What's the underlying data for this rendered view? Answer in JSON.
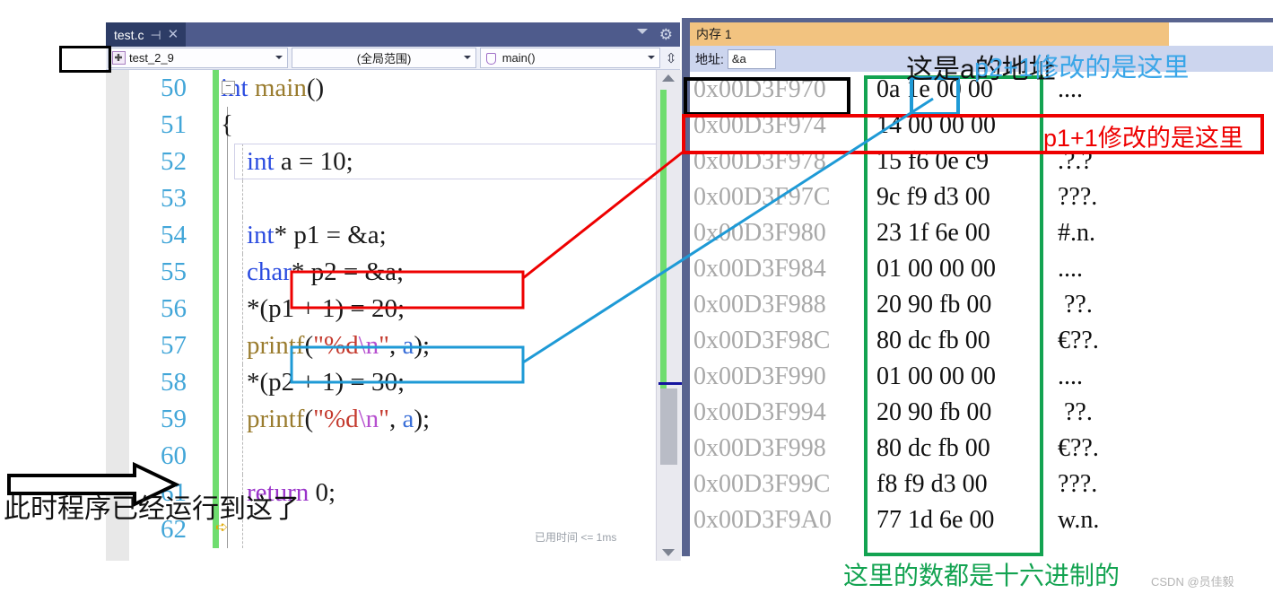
{
  "editor": {
    "tab": {
      "title": "test.c",
      "pin_icon": "pin-icon",
      "close_icon": "close-icon"
    },
    "tabbar": {
      "chevron_icon": "chevron-down-icon",
      "gear_icon": "gear-icon"
    },
    "nav": {
      "project": "test_2_9",
      "scope": "(全局范围)",
      "function": "main()",
      "split_icon": "split-window-icon"
    },
    "first_line_number": 50,
    "lines": [
      {
        "num": "50",
        "tokens": [
          {
            "t": "int ",
            "c": "kw"
          },
          {
            "t": "main",
            "c": "fn"
          },
          {
            "t": "()",
            "c": "pl"
          }
        ]
      },
      {
        "num": "51",
        "tokens": [
          {
            "t": "{",
            "c": "pl"
          }
        ]
      },
      {
        "num": "52",
        "tokens": [
          {
            "t": "    ",
            "c": "pl"
          },
          {
            "t": "int",
            "c": "kw"
          },
          {
            "t": " a = ",
            "c": "pl"
          },
          {
            "t": "10",
            "c": "num"
          },
          {
            "t": ";",
            "c": "pl"
          }
        ]
      },
      {
        "num": "53",
        "tokens": []
      },
      {
        "num": "54",
        "tokens": [
          {
            "t": "    ",
            "c": "pl"
          },
          {
            "t": "int",
            "c": "kw"
          },
          {
            "t": "* p1 = &a;",
            "c": "pl"
          }
        ]
      },
      {
        "num": "55",
        "tokens": [
          {
            "t": "    ",
            "c": "pl"
          },
          {
            "t": "char",
            "c": "kw"
          },
          {
            "t": "* p2 = &a;",
            "c": "pl"
          }
        ]
      },
      {
        "num": "56",
        "tokens": [
          {
            "t": "    *(p1 + 1) = ",
            "c": "pl"
          },
          {
            "t": "20",
            "c": "num"
          },
          {
            "t": ";",
            "c": "pl"
          }
        ]
      },
      {
        "num": "57",
        "tokens": [
          {
            "t": "    ",
            "c": "pl"
          },
          {
            "t": "printf",
            "c": "fn"
          },
          {
            "t": "(",
            "c": "pl"
          },
          {
            "t": "\"%d",
            "c": "str"
          },
          {
            "t": "\\n",
            "c": "esc"
          },
          {
            "t": "\"",
            "c": "str"
          },
          {
            "t": ", ",
            "c": "pl"
          },
          {
            "t": "a",
            "c": "var"
          },
          {
            "t": ");",
            "c": "pl"
          }
        ]
      },
      {
        "num": "58",
        "tokens": [
          {
            "t": "    *(p2 + 1) = ",
            "c": "pl"
          },
          {
            "t": "30",
            "c": "num"
          },
          {
            "t": ";",
            "c": "pl"
          }
        ]
      },
      {
        "num": "59",
        "tokens": [
          {
            "t": "    ",
            "c": "pl"
          },
          {
            "t": "printf",
            "c": "fn"
          },
          {
            "t": "(",
            "c": "pl"
          },
          {
            "t": "\"%d",
            "c": "str"
          },
          {
            "t": "\\n",
            "c": "esc"
          },
          {
            "t": "\"",
            "c": "str"
          },
          {
            "t": ", ",
            "c": "pl"
          },
          {
            "t": "a",
            "c": "var"
          },
          {
            "t": ");",
            "c": "pl"
          }
        ]
      },
      {
        "num": "60",
        "tokens": []
      },
      {
        "num": "61",
        "tokens": [
          {
            "t": "    ",
            "c": "pl"
          },
          {
            "t": "return",
            "c": "ret"
          },
          {
            "t": " ",
            "c": "pl"
          },
          {
            "t": "0",
            "c": "num"
          },
          {
            "t": ";",
            "c": "pl"
          }
        ]
      },
      {
        "num": "62",
        "tokens": [
          {
            "t": "",
            "c": "pl"
          }
        ]
      }
    ],
    "elapsed_time": "已用时间 <= 1ms",
    "execution_pointer_icon": "execution-pointer-icon",
    "collapse_glyph": "−"
  },
  "memory": {
    "tab_title": "内存 1",
    "address_label": "地址:",
    "address_value": "&a",
    "address_placeholder": "地址",
    "rows": [
      {
        "addr": "0x00D3F970",
        "hex": "0a 1e 00 00",
        "ascii": "...."
      },
      {
        "addr": "0x00D3F974",
        "hex": "14 00 00 00",
        "ascii": ""
      },
      {
        "addr": "0x00D3F978",
        "hex": "15 f6 0e c9",
        "ascii": ".?.?"
      },
      {
        "addr": "0x00D3F97C",
        "hex": "9c f9 d3 00",
        "ascii": "???."
      },
      {
        "addr": "0x00D3F980",
        "hex": "23 1f 6e 00",
        "ascii": "#.n."
      },
      {
        "addr": "0x00D3F984",
        "hex": "01 00 00 00",
        "ascii": "...."
      },
      {
        "addr": "0x00D3F988",
        "hex": "20 90 fb 00",
        "ascii": " ??."
      },
      {
        "addr": "0x00D3F98C",
        "hex": "80 dc fb 00",
        "ascii": "€??."
      },
      {
        "addr": "0x00D3F990",
        "hex": "01 00 00 00",
        "ascii": "...."
      },
      {
        "addr": "0x00D3F994",
        "hex": "20 90 fb 00",
        "ascii": " ??."
      },
      {
        "addr": "0x00D3F998",
        "hex": "80 dc fb 00",
        "ascii": "€??."
      },
      {
        "addr": "0x00D3F99C",
        "hex": "f8 f9 d3 00",
        "ascii": "???."
      },
      {
        "addr": "0x00D3F9A0",
        "hex": "77 1d 6e 00",
        "ascii": "w.n."
      }
    ]
  },
  "annotations": {
    "a_address": "这是a的地址",
    "p2_plus_one": "p2+1修改的是这里",
    "p1_plus_one": "p1+1修改的是这里",
    "hex_note": "这里的数都是十六进制的",
    "program_position": "此时程序已经运行到这了"
  },
  "colors": {
    "red": "#ee0000",
    "blue": "#1e9ad6",
    "green": "#13a351",
    "orange_tab": "#f2c380",
    "tab_dark": "#2d3c66",
    "tabbar": "#4e5b8c",
    "change_bar_green": "#6fdd6f",
    "line_number": "#42a6d8"
  },
  "watermark": "CSDN @员佳毅"
}
